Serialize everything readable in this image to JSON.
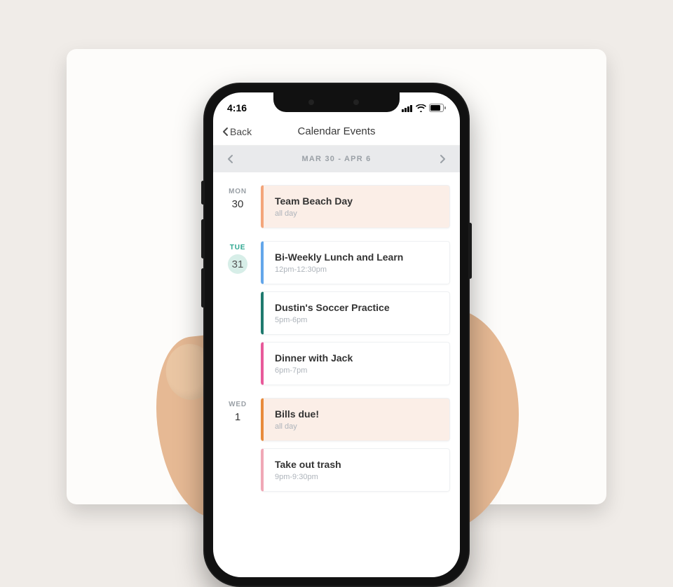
{
  "status": {
    "time": "4:16"
  },
  "nav": {
    "back": "Back",
    "title": "Calendar Events"
  },
  "week": {
    "range": "MAR 30 - APR 6"
  },
  "days": [
    {
      "label": "MON",
      "num": "30",
      "selected": false,
      "events": [
        {
          "title": "Team Beach Day",
          "time": "all day",
          "style": "peach"
        }
      ]
    },
    {
      "label": "TUE",
      "num": "31",
      "selected": true,
      "events": [
        {
          "title": "Bi-Weekly Lunch and Learn",
          "time": "12pm-12:30pm",
          "style": "blue"
        },
        {
          "title": "Dustin's Soccer Practice",
          "time": "5pm-6pm",
          "style": "teal"
        },
        {
          "title": "Dinner with Jack",
          "time": "6pm-7pm",
          "style": "pink"
        }
      ]
    },
    {
      "label": "WED",
      "num": "1",
      "selected": false,
      "events": [
        {
          "title": "Bills due!",
          "time": "all day",
          "style": "orange"
        },
        {
          "title": "Take out trash",
          "time": "9pm-9:30pm",
          "style": "rose"
        }
      ]
    }
  ]
}
